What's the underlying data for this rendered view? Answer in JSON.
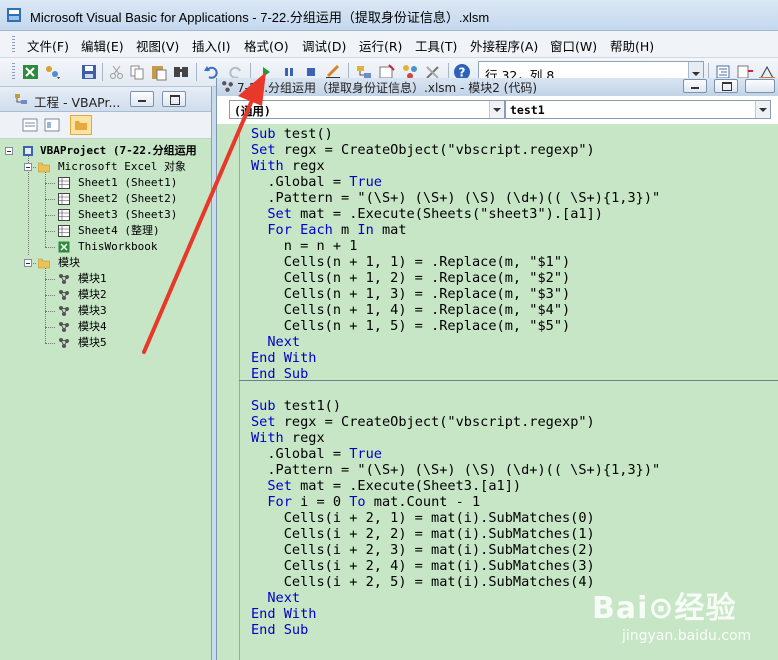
{
  "window": {
    "title": "Microsoft Visual Basic for Applications - 7-22.分组运用（提取身份证信息）.xlsm"
  },
  "menu": [
    {
      "label": "文件(F)",
      "name": "menu-file"
    },
    {
      "label": "编辑(E)",
      "name": "menu-edit"
    },
    {
      "label": "视图(V)",
      "name": "menu-view"
    },
    {
      "label": "插入(I)",
      "name": "menu-insert"
    },
    {
      "label": "格式(O)",
      "name": "menu-format"
    },
    {
      "label": "调试(D)",
      "name": "menu-debug"
    },
    {
      "label": "运行(R)",
      "name": "menu-run"
    },
    {
      "label": "工具(T)",
      "name": "menu-tools"
    },
    {
      "label": "外接程序(A)",
      "name": "menu-addins"
    },
    {
      "label": "窗口(W)",
      "name": "menu-window"
    },
    {
      "label": "帮助(H)",
      "name": "menu-help"
    }
  ],
  "toolbar": {
    "position_text": "行 32，列 8"
  },
  "project_panel": {
    "title": "工程 - VBAPr...",
    "tree": [
      {
        "label": "VBAProject (7-22.分组运用",
        "level": 0,
        "icon": "project-icon",
        "bold": true
      },
      {
        "label": "Microsoft Excel 对象",
        "level": 1,
        "icon": "folder-icon"
      },
      {
        "label": "Sheet1 (Sheet1)",
        "level": 2,
        "icon": "sheet-icon"
      },
      {
        "label": "Sheet2 (Sheet2)",
        "level": 2,
        "icon": "sheet-icon"
      },
      {
        "label": "Sheet3 (Sheet3)",
        "level": 2,
        "icon": "sheet-icon"
      },
      {
        "label": "Sheet4 (整理)",
        "level": 2,
        "icon": "sheet-icon"
      },
      {
        "label": "ThisWorkbook",
        "level": 2,
        "icon": "workbook-icon"
      },
      {
        "label": "模块",
        "level": 1,
        "icon": "folder-icon"
      },
      {
        "label": "模块1",
        "level": 2,
        "icon": "module-icon"
      },
      {
        "label": "模块2",
        "level": 2,
        "icon": "module-icon"
      },
      {
        "label": "模块3",
        "level": 2,
        "icon": "module-icon"
      },
      {
        "label": "模块4",
        "level": 2,
        "icon": "module-icon"
      },
      {
        "label": "模块5",
        "level": 2,
        "icon": "module-icon"
      }
    ]
  },
  "code_window": {
    "title": "7-22.分组运用（提取身份证信息）.xlsm - 模块2 (代码)",
    "object_combo": "(通用)",
    "proc_combo": "test1",
    "lines": [
      "Sub test()",
      "Set regx = CreateObject(\"vbscript.regexp\")",
      "With regx",
      "  .Global = True",
      "  .Pattern = \"(\\S+) (\\S+) (\\S) (\\d+)(( \\S+){1,3})\"",
      "  Set mat = .Execute(Sheets(\"sheet3\").[a1])",
      "  For Each m In mat",
      "    n = n + 1",
      "    Cells(n + 1, 1) = .Replace(m, \"$1\")",
      "    Cells(n + 1, 2) = .Replace(m, \"$2\")",
      "    Cells(n + 1, 3) = .Replace(m, \"$3\")",
      "    Cells(n + 1, 4) = .Replace(m, \"$4\")",
      "    Cells(n + 1, 5) = .Replace(m, \"$5\")",
      "  Next",
      "End With",
      "End Sub",
      "",
      "Sub test1()",
      "Set regx = CreateObject(\"vbscript.regexp\")",
      "With regx",
      "  .Global = True",
      "  .Pattern = \"(\\S+) (\\S+) (\\S) (\\d+)(( \\S+){1,3})\"",
      "  Set mat = .Execute(Sheet3.[a1])",
      "  For i = 0 To mat.Count - 1",
      "    Cells(i + 2, 1) = mat(i).SubMatches(0)",
      "    Cells(i + 2, 2) = mat(i).SubMatches(1)",
      "    Cells(i + 2, 3) = mat(i).SubMatches(2)",
      "    Cells(i + 2, 4) = mat(i).SubMatches(3)",
      "    Cells(i + 2, 5) = mat(i).SubMatches(4)",
      "  Next",
      "End With",
      "End Sub"
    ]
  },
  "watermark": {
    "logo": "Bai⊙经验",
    "url": "jingyan.baidu.com"
  },
  "colors": {
    "code_background": "#c6e6c6",
    "keyword": "#0000c8",
    "arrow": "#e8382a"
  }
}
